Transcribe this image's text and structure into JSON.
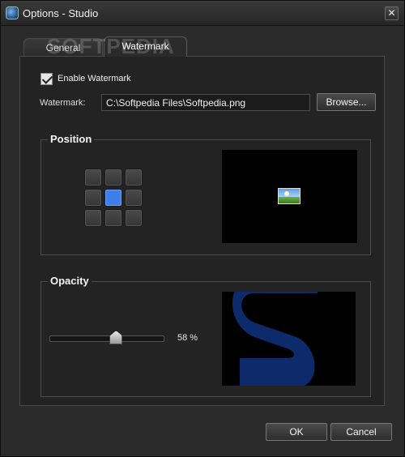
{
  "window": {
    "title": "Options - Studio",
    "close_label": "✕"
  },
  "tabs": [
    {
      "label": "General",
      "selected": false
    },
    {
      "label": "Watermark",
      "selected": true
    }
  ],
  "overlay_watermark": "SOFTPEDIA",
  "watermark": {
    "enable_label": "Enable Watermark",
    "enabled": true,
    "field_label": "Watermark:",
    "file_path": "C:\\Softpedia Files\\Softpedia.png",
    "browse_label": "Browse..."
  },
  "position": {
    "title": "Position",
    "selected_cell": "middle-center",
    "cells": [
      "top-left",
      "top-center",
      "top-right",
      "middle-left",
      "middle-center",
      "middle-right",
      "bottom-left",
      "bottom-center",
      "bottom-right"
    ]
  },
  "opacity": {
    "title": "Opacity",
    "value_percent": 58,
    "value_text": "58 %"
  },
  "buttons": {
    "ok": "OK",
    "cancel": "Cancel"
  },
  "colors": {
    "accent": "#3e7ee8",
    "preview_logo": "#0d2a6b"
  }
}
